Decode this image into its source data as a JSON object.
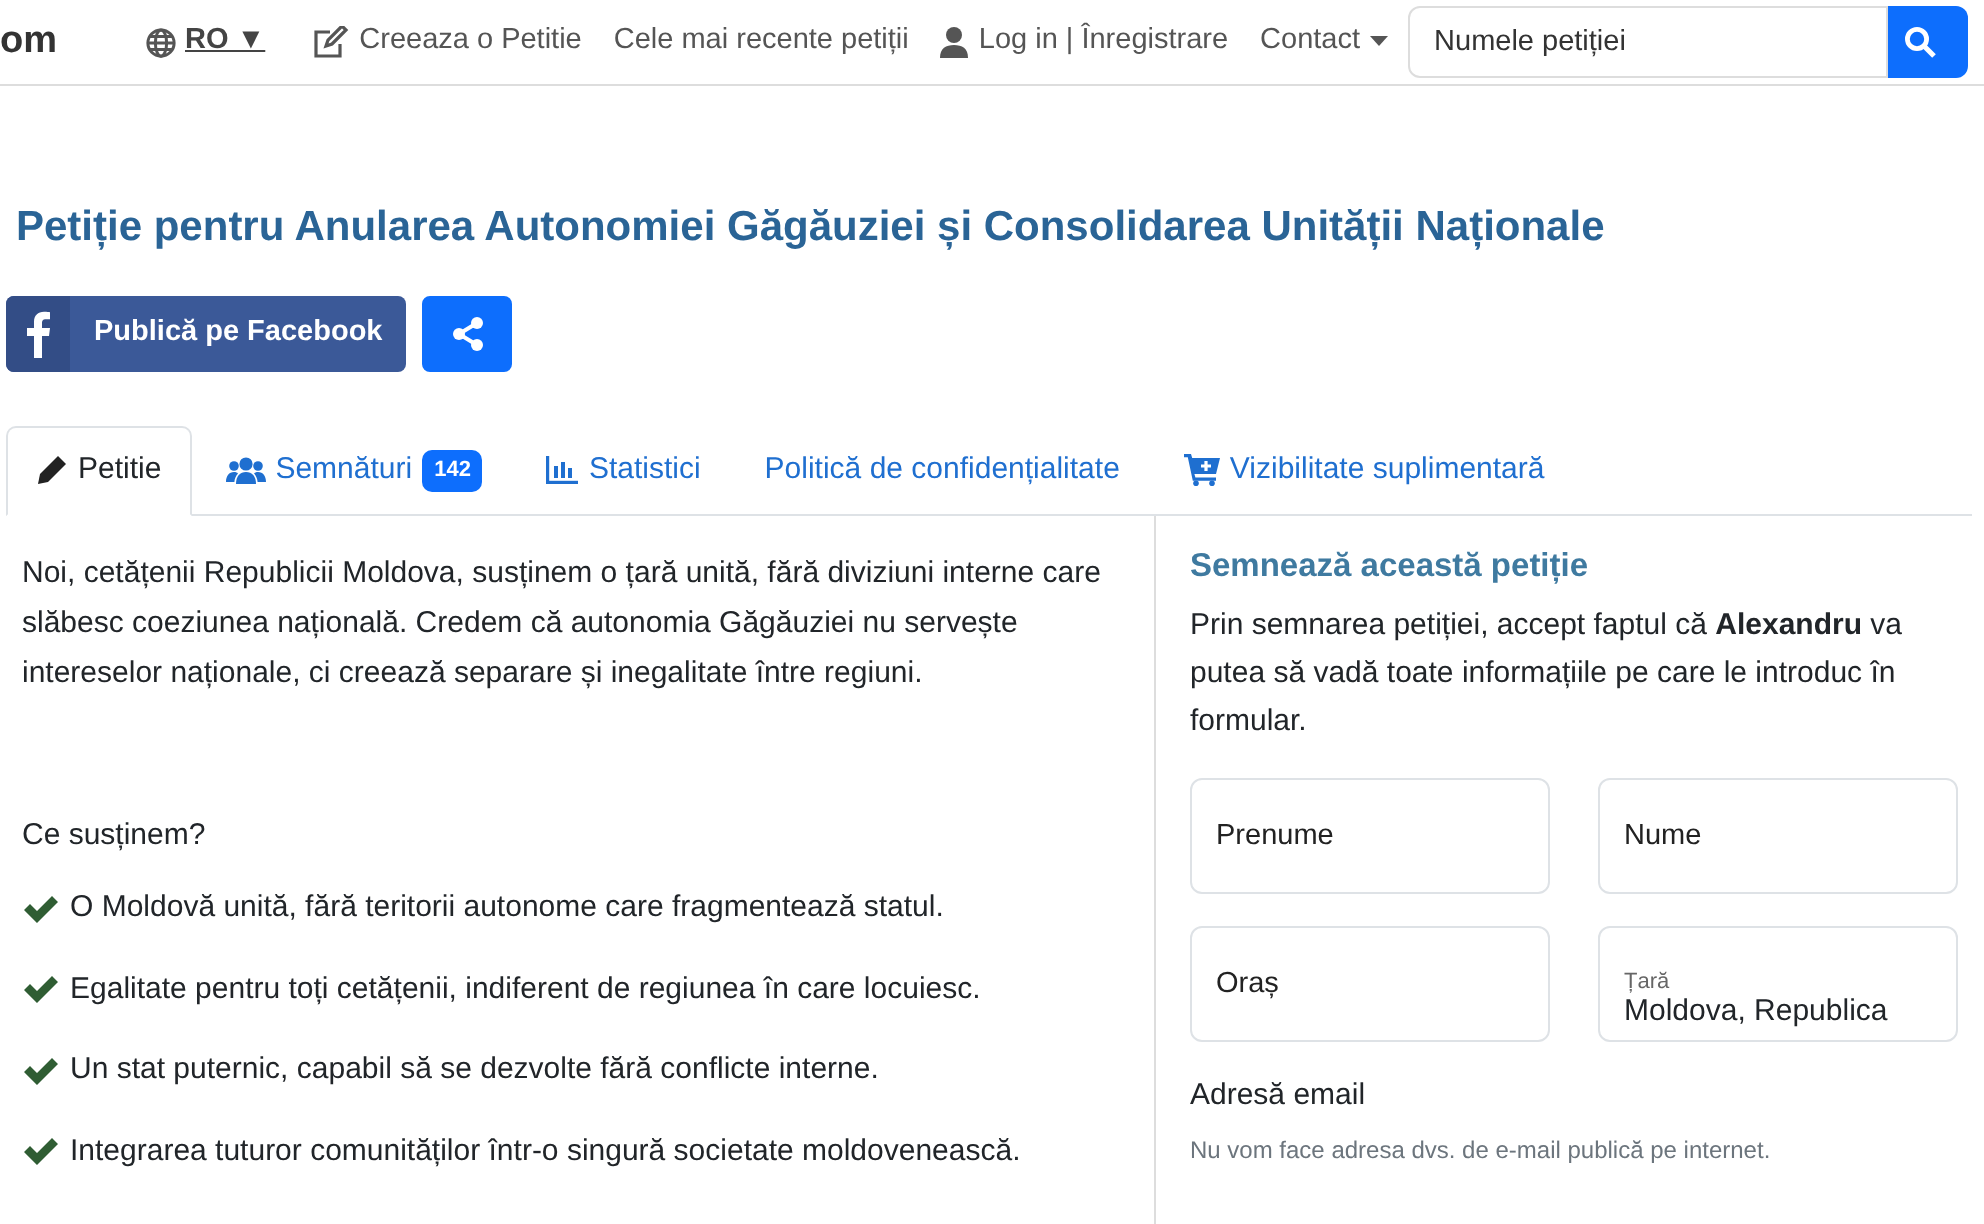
{
  "navbar": {
    "brand": "om",
    "language": {
      "label": "RO ▼"
    },
    "links": [
      {
        "kind": "create",
        "label": "Creeaza o Petitie"
      },
      {
        "kind": "plain",
        "label": "Cele mai recente petiții"
      },
      {
        "kind": "login",
        "label": "Log in | Înregistrare"
      },
      {
        "kind": "dropdown",
        "label": "Contact"
      }
    ],
    "search": {
      "placeholder": "Numele petiției"
    }
  },
  "title": "Petiție pentru Anularea Autonomiei Găgăuziei și Consolidarea Unității Naționale",
  "share": {
    "facebook_label": "Publică pe Facebook"
  },
  "tabs": [
    {
      "kind": "petition",
      "label": "Petitie",
      "selected": true
    },
    {
      "kind": "signatures",
      "label": "Semnături",
      "badge": "142",
      "selected": false
    },
    {
      "kind": "stats",
      "label": "Statistici",
      "selected": false
    },
    {
      "kind": "plain",
      "label": "Politică de confidențialitate",
      "selected": false
    },
    {
      "kind": "cart",
      "label": "Vizibilitate suplimentară",
      "selected": false
    }
  ],
  "petition": {
    "intro": "Noi, cetățenii Republicii Moldova, susținem o țară unită, fără diviziuni interne care slăbesc coeziunea națională. Credem că autonomia Găgăuziei nu servește intereselor naționale, ci creează separare și inegalitate între regiuni.",
    "subheading": "Ce susținem?",
    "points": [
      "O Moldovă unită, fără teritorii autonome care fragmentează statul.",
      "Egalitate pentru toți cetățenii, indiferent de regiunea în care locuiesc.",
      "Un stat puternic, capabil să se dezvolte fără conflicte interne.",
      "Integrarea tuturor comunităților într-o singură societate moldovenească."
    ]
  },
  "sign_form": {
    "heading": "Semnează această petiție",
    "consent": "Prin semnarea petiției, accept faptul că **Alexandru** va putea să vadă toate informațiile pe care le introduc în formular.",
    "fields": [
      {
        "kind": "input",
        "placeholder": "Prenume"
      },
      {
        "kind": "input",
        "placeholder": "Nume"
      },
      {
        "kind": "input",
        "placeholder": "Oraș"
      },
      {
        "kind": "select",
        "label": "Țară",
        "value": "Moldova, Republica"
      }
    ],
    "email_label": "Adresă email",
    "email_help": "Nu vom face adresa dvs. de e-mail publică pe internet."
  }
}
